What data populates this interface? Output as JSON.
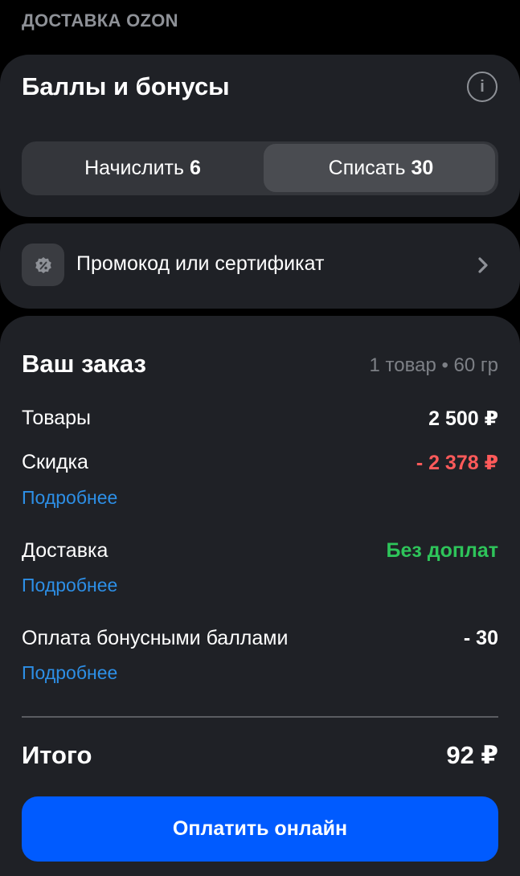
{
  "section_caption": "ДОСТАВКА OZON",
  "bonus": {
    "title": "Баллы и бонусы",
    "info_icon": "info-icon",
    "segments": {
      "accrue_label": "Начислить",
      "accrue_value": "6",
      "spend_label": "Списать",
      "spend_value": "30",
      "active": "spend"
    }
  },
  "promo": {
    "icon": "percent-badge-icon",
    "label": "Промокод или сертификат",
    "chevron": "chevron-right-icon"
  },
  "order": {
    "title": "Ваш заказ",
    "meta": "1 товар • 60 гр",
    "rows": {
      "goods_label": "Товары",
      "goods_value": "2 500 ₽",
      "discount_label": "Скидка",
      "discount_value": "- 2 378 ₽",
      "discount_link": "Подробнее",
      "delivery_label": "Доставка",
      "delivery_value": "Без доплат",
      "delivery_link": "Подробнее",
      "points_label": "Оплата бонусными баллами",
      "points_value": "- 30",
      "points_link": "Подробнее"
    },
    "total_label": "Итого",
    "total_value": "92 ₽",
    "pay_button": "Оплатить онлайн"
  },
  "colors": {
    "background": "#000000",
    "card": "#1f2126",
    "accent_blue": "#005bff",
    "link_blue": "#2d8fe6",
    "discount_red": "#ff5a5a",
    "success_green": "#2ec45a",
    "muted": "#8e9197"
  }
}
